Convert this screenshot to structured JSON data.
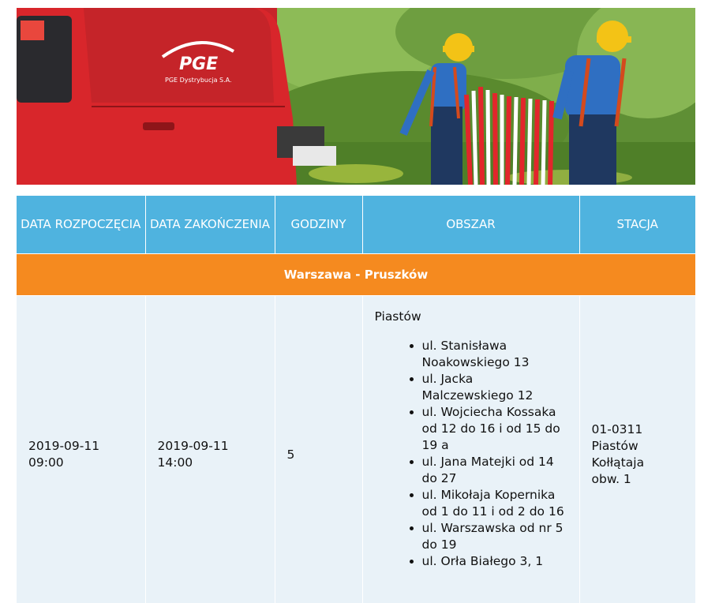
{
  "banner": {
    "logo_text": "PGE",
    "company_text": "PGE Dystrybucja S.A."
  },
  "table": {
    "headers": {
      "start_date": "DATA ROZPOCZĘCIA",
      "end_date": "DATA ZAKOŃCZENIA",
      "hours": "GODZINY",
      "area": "OBSZAR",
      "station": "STACJA"
    },
    "group": "Warszawa - Pruszków",
    "rows": [
      {
        "start_date": "2019-09-11",
        "start_time": "09:00",
        "end_date": "2019-09-11",
        "end_time": "14:00",
        "hours": "5",
        "area_place": "Piastów",
        "streets": [
          "ul. Stanisława Noakowskiego 13",
          "ul. Jacka Malczewskiego 12",
          "ul. Wojciecha Kossaka od 12 do 16 i od 15 do 19 a",
          "ul. Jana Matejki od 14 do 27",
          "ul. Mikołaja Kopernika od 1 do 11 i od 2 do 16",
          "ul. Warszawska od nr 5 do 19",
          "ul. Orła Białego 3, 1"
        ],
        "station_line1": "01-0311",
        "station_line2": "Piastów",
        "station_line3": "Kołłątaja",
        "station_line4": "obw. 1"
      }
    ]
  },
  "colors": {
    "header_bg": "#4fb3df",
    "group_bg": "#f58a1f",
    "row_bg": "#e9f2f8",
    "truck_red": "#d8262b"
  }
}
